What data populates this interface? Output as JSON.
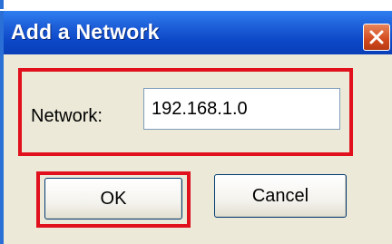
{
  "dialog": {
    "title": "Add a Network",
    "close_icon": "close-x-icon"
  },
  "network": {
    "label": "Network:",
    "value": "192.168.1.0"
  },
  "buttons": {
    "ok_label": "OK",
    "cancel_label": "Cancel"
  },
  "colors": {
    "titlebar": "#0b47c7",
    "dialog_bg": "#ece9d8",
    "highlight_box": "#e0101c",
    "close_button": "#d24a1e"
  }
}
